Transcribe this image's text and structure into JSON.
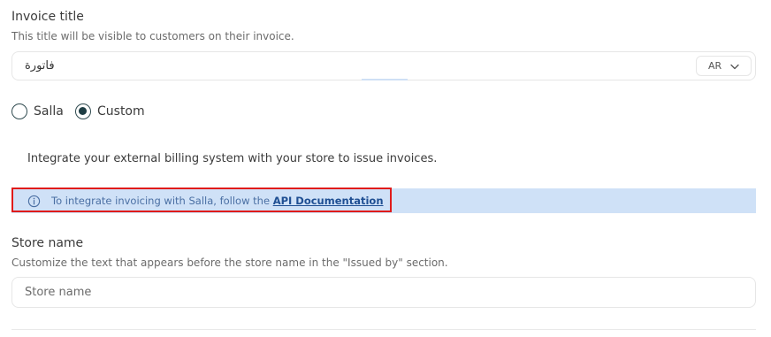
{
  "invoice_title": {
    "label": "Invoice title",
    "description": "This title will be visible to customers on their invoice.",
    "value": "فاتورة",
    "language_select": "AR"
  },
  "provider_options": [
    {
      "label": "Salla",
      "selected": false
    },
    {
      "label": "Custom",
      "selected": true
    }
  ],
  "integration": {
    "description": "Integrate your external billing system with your store to issue invoices.",
    "info_prefix": "To integrate invoicing with Salla, follow the ",
    "info_link": "API Documentation"
  },
  "store_name": {
    "label": "Store name",
    "description": "Customize the text that appears before the store name in the \"Issued by\" section.",
    "placeholder": "Store name"
  },
  "colors": {
    "info_background": "#cfe1f7",
    "highlight_border": "#e01b1b",
    "radio_accent": "#1f3e44",
    "link": "#1f4f93"
  },
  "icons": {
    "info": "info-circle-icon",
    "dropdown": "chevron-down-icon"
  }
}
